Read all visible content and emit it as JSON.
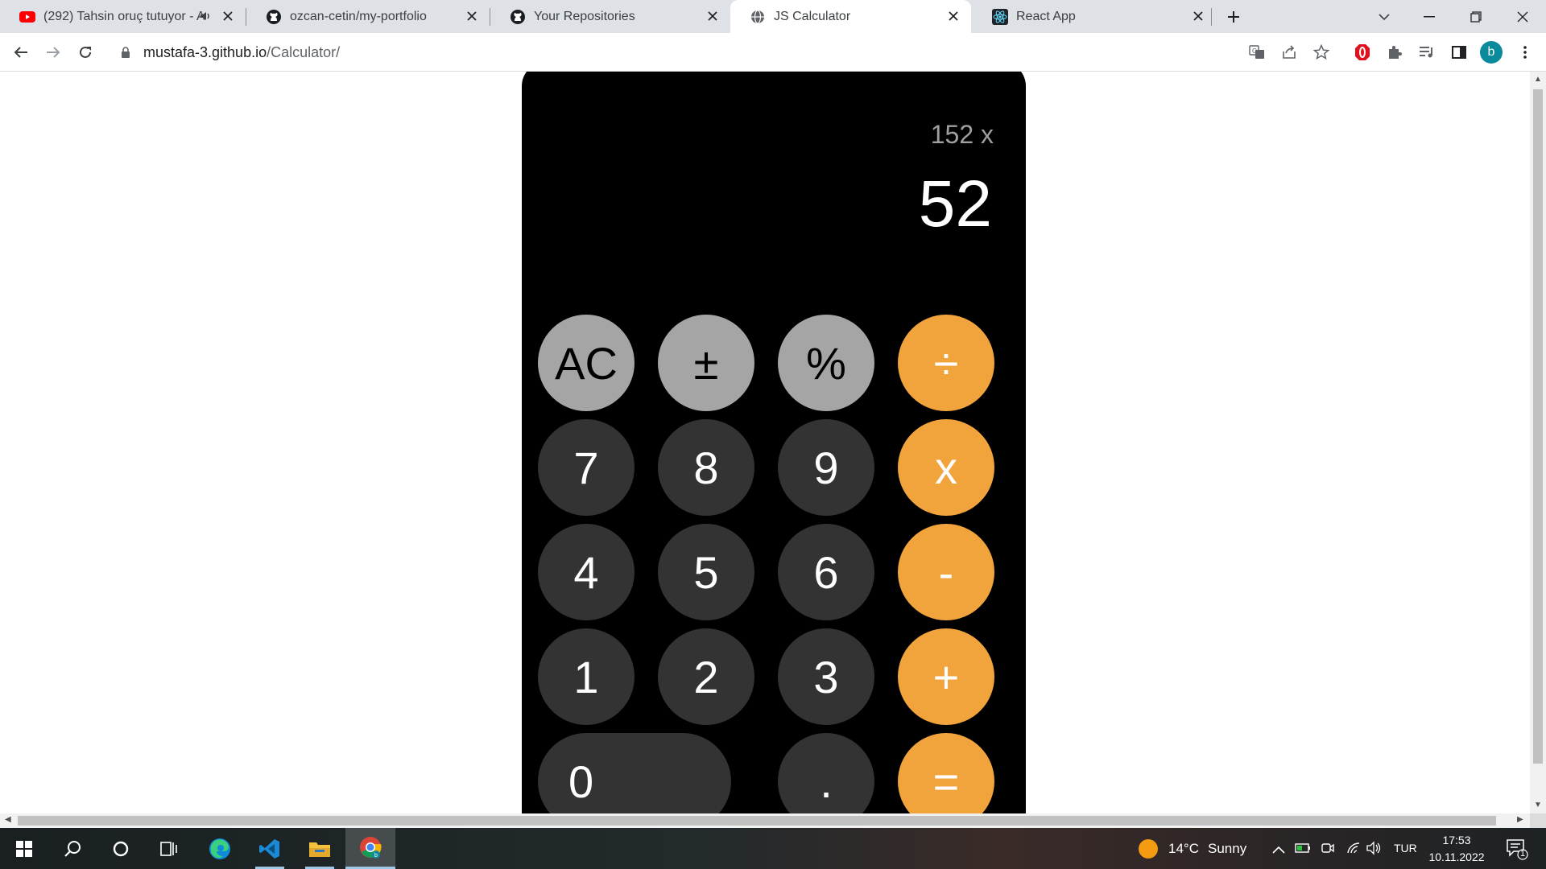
{
  "browser": {
    "tabs": [
      {
        "title": "(292) Tahsin oruç tutuyor - A",
        "favicon": "youtube-icon",
        "audio": true
      },
      {
        "title": "ozcan-cetin/my-portfolio",
        "favicon": "github-icon"
      },
      {
        "title": "Your Repositories",
        "favicon": "github-icon"
      },
      {
        "title": "JS Calculator",
        "favicon": "globe-icon",
        "active": true
      },
      {
        "title": "React App",
        "favicon": "react-icon"
      }
    ],
    "url_host": "mustafa-3.github.io",
    "url_path": "/Calculator/",
    "profile_initial": "b"
  },
  "calculator": {
    "history": "152 x",
    "result": "52",
    "keys": {
      "ac": "AC",
      "sign": "±",
      "percent": "%",
      "divide": "÷",
      "k7": "7",
      "k8": "8",
      "k9": "9",
      "multiply": "x",
      "k4": "4",
      "k5": "5",
      "k6": "6",
      "minus": "-",
      "k1": "1",
      "k2": "2",
      "k3": "3",
      "plus": "+",
      "k0": "0",
      "dot": ".",
      "equals": "="
    },
    "colors": {
      "function": "#a5a5a5",
      "number": "#333333",
      "operator": "#f1a33c",
      "body": "#000000"
    }
  },
  "taskbar": {
    "weather_temp": "14°C",
    "weather_desc": "Sunny",
    "language": "TUR",
    "time": "17:53",
    "date": "10.11.2022",
    "notification_count": "1"
  }
}
